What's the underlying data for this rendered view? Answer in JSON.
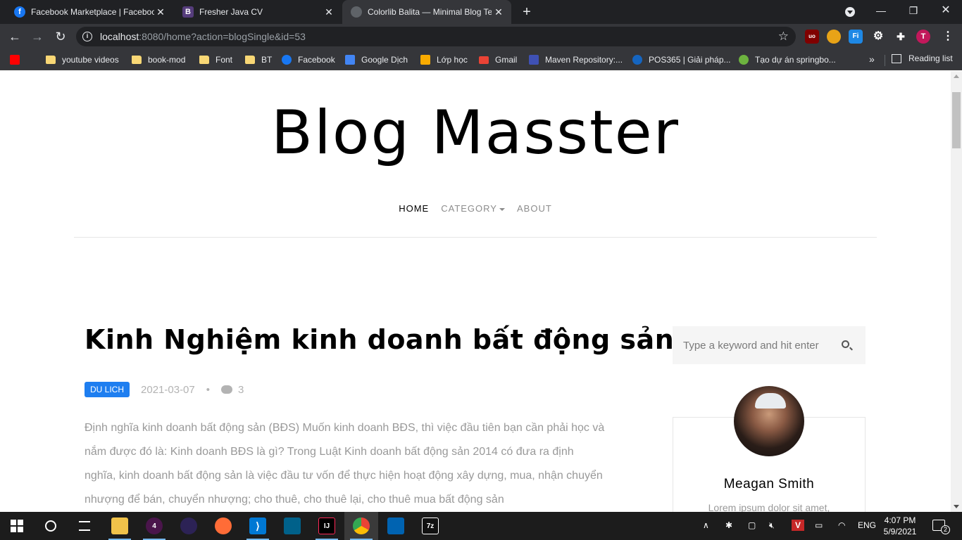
{
  "browser": {
    "tabs": [
      {
        "title": "Facebook Marketplace | Facebook",
        "icon": "facebook-icon",
        "color": "#1877f2",
        "glyph": "f"
      },
      {
        "title": "Fresher Java CV",
        "icon": "bootstrap-icon",
        "color": "#563d7c",
        "glyph": "B"
      },
      {
        "title": "Colorlib Balita — Minimal Blog Template",
        "icon": "globe-icon",
        "color": "#5f6368",
        "glyph": ""
      }
    ],
    "url_host": "localhost",
    "url_rest": ":8080/home?action=blogSingle&id=53",
    "extensions": [
      {
        "name": "ublock-icon",
        "glyph": "uo",
        "color": "#800000"
      },
      {
        "name": "extension-orange-icon",
        "glyph": "",
        "color": "#e8a317"
      },
      {
        "name": "fi-extension-icon",
        "glyph": "Fi",
        "color": "#1e88e5"
      },
      {
        "name": "gear-extension-icon",
        "glyph": "⚙",
        "color": "#35363a"
      },
      {
        "name": "puzzle-icon",
        "glyph": "✚",
        "color": "#35363a"
      },
      {
        "name": "profile-avatar-icon",
        "glyph": "T",
        "color": "#c2185b"
      }
    ],
    "bookmarks": [
      {
        "label": "",
        "icon": "youtube-icon",
        "color": "#ff0000"
      },
      {
        "label": "youtube videos",
        "icon": "folder-icon"
      },
      {
        "label": "book-mod",
        "icon": "folder-icon"
      },
      {
        "label": "Font",
        "icon": "folder-icon"
      },
      {
        "label": "BT",
        "icon": "folder-icon"
      },
      {
        "label": "Facebook",
        "icon": "facebook-icon",
        "color": "#1877f2"
      },
      {
        "label": "Google Dịch",
        "icon": "google-translate-icon",
        "color": "#4285f4"
      },
      {
        "label": "Lớp học",
        "icon": "classroom-icon",
        "color": "#f9ab00"
      },
      {
        "label": "Gmail",
        "icon": "gmail-icon",
        "color": "#ea4335"
      },
      {
        "label": "Maven Repository:...",
        "icon": "maven-icon",
        "color": "#3f51b5"
      },
      {
        "label": "POS365 | Giải pháp...",
        "icon": "pos365-icon",
        "color": "#1565c0"
      },
      {
        "label": "Tạo dự án springbo...",
        "icon": "spring-icon",
        "color": "#6db33f"
      }
    ],
    "reading_list": "Reading list",
    "bookmarks_more": "»"
  },
  "site": {
    "title": "Blog Masster",
    "nav": {
      "home": "HOME",
      "category": "CATEGORY",
      "about": "ABOUT"
    }
  },
  "post": {
    "title": "Kinh Nghiệm kinh doanh bất động sản",
    "category": "DU LICH",
    "date": "2021-03-07",
    "separator": "•",
    "comments": "3",
    "body": "Định nghĩa kinh doanh bất động sản (BĐS) Muốn kinh doanh BĐS, thì việc đầu tiên bạn cần phải học và nắm được đó là: Kinh doanh BĐS là gì? Trong Luật Kinh doanh bất động sản 2014 có đưa ra định nghĩa, kinh doanh bất động sản là việc đầu tư vốn để thực hiện hoạt động xây dựng, mua, nhận chuyển nhượng để bán, chuyển nhượng; cho thuê, cho thuê lại, cho thuê mua bất động sản"
  },
  "sidebar": {
    "search_placeholder": "Type a keyword and hit enter",
    "author_name": "Meagan Smith",
    "author_bio": "Lorem ipsum dolor sit amet,"
  },
  "taskbar": {
    "apps": [
      {
        "name": "file-explorer-icon",
        "color": "#f0c24a",
        "glyph": ""
      },
      {
        "name": "slack-icon",
        "color": "#4a154b",
        "glyph": "4"
      },
      {
        "name": "eclipse-icon",
        "color": "#2c2255",
        "glyph": ""
      },
      {
        "name": "postman-icon",
        "color": "#ff6c37",
        "glyph": ""
      },
      {
        "name": "vscode-icon",
        "color": "#0078d4",
        "glyph": "⟩"
      },
      {
        "name": "mysql-workbench-icon",
        "color": "#00618a",
        "glyph": ""
      },
      {
        "name": "intellij-icon",
        "color": "#000000",
        "glyph": "IJ"
      },
      {
        "name": "chrome-icon",
        "color": "#4285f4",
        "glyph": ""
      },
      {
        "name": "photos-icon",
        "color": "#0063b1",
        "glyph": ""
      },
      {
        "name": "7zip-icon",
        "color": "#111111",
        "glyph": "7z"
      }
    ],
    "language": "ENG",
    "time": "4:07 PM",
    "date": "5/9/2021",
    "notifications": "2"
  }
}
